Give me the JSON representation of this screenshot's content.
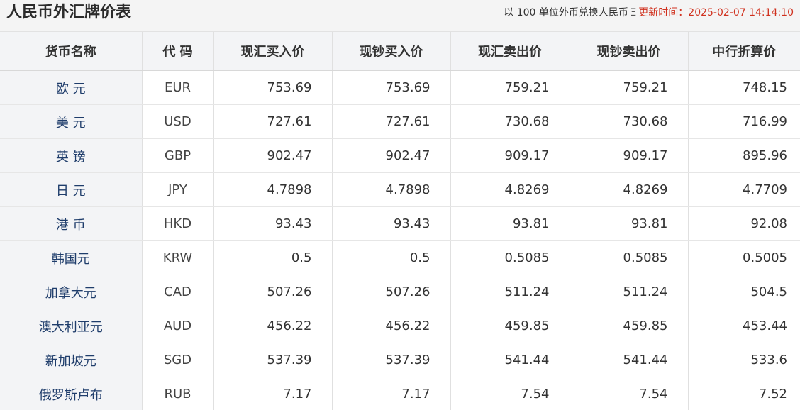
{
  "header": {
    "title": "人民币外汇牌价表",
    "unit_note": "以 100 单位外币兑换人民币",
    "separator": " Ξ ",
    "update_label": "更新时间：",
    "update_time": "2025-02-07 14:14:10"
  },
  "table": {
    "columns": [
      "货币名称",
      "代 码",
      "现汇买入价",
      "现钞买入价",
      "现汇卖出价",
      "现钞卖出价",
      "中行折算价"
    ],
    "rows": [
      {
        "name": "欧 元",
        "code": "EUR",
        "spot_buy": "753.69",
        "cash_buy": "753.69",
        "spot_sell": "759.21",
        "cash_sell": "759.21",
        "boc_rate": "748.15"
      },
      {
        "name": "美 元",
        "code": "USD",
        "spot_buy": "727.61",
        "cash_buy": "727.61",
        "spot_sell": "730.68",
        "cash_sell": "730.68",
        "boc_rate": "716.99"
      },
      {
        "name": "英 镑",
        "code": "GBP",
        "spot_buy": "902.47",
        "cash_buy": "902.47",
        "spot_sell": "909.17",
        "cash_sell": "909.17",
        "boc_rate": "895.96"
      },
      {
        "name": "日 元",
        "code": "JPY",
        "spot_buy": "4.7898",
        "cash_buy": "4.7898",
        "spot_sell": "4.8269",
        "cash_sell": "4.8269",
        "boc_rate": "4.7709"
      },
      {
        "name": "港 币",
        "code": "HKD",
        "spot_buy": "93.43",
        "cash_buy": "93.43",
        "spot_sell": "93.81",
        "cash_sell": "93.81",
        "boc_rate": "92.08"
      },
      {
        "name": "韩国元",
        "code": "KRW",
        "spot_buy": "0.5",
        "cash_buy": "0.5",
        "spot_sell": "0.5085",
        "cash_sell": "0.5085",
        "boc_rate": "0.5005"
      },
      {
        "name": "加拿大元",
        "code": "CAD",
        "spot_buy": "507.26",
        "cash_buy": "507.26",
        "spot_sell": "511.24",
        "cash_sell": "511.24",
        "boc_rate": "504.5"
      },
      {
        "name": "澳大利亚元",
        "code": "AUD",
        "spot_buy": "456.22",
        "cash_buy": "456.22",
        "spot_sell": "459.85",
        "cash_sell": "459.85",
        "boc_rate": "453.44"
      },
      {
        "name": "新加坡元",
        "code": "SGD",
        "spot_buy": "537.39",
        "cash_buy": "537.39",
        "spot_sell": "541.44",
        "cash_sell": "541.44",
        "boc_rate": "533.6"
      },
      {
        "name": "俄罗斯卢布",
        "code": "RUB",
        "spot_buy": "7.17",
        "cash_buy": "7.17",
        "spot_sell": "7.54",
        "cash_sell": "7.54",
        "boc_rate": "7.52"
      }
    ]
  },
  "colors": {
    "update_time": "#d0311e",
    "currency_name": "#1f3d6b",
    "header_bg": "#f3f4f6"
  }
}
